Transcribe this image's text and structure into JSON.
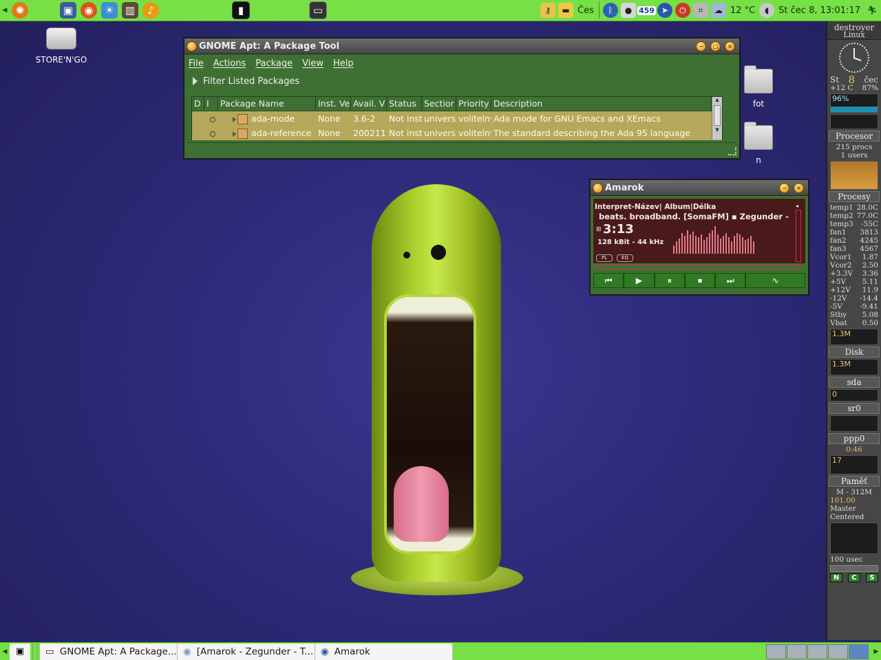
{
  "top_panel": {
    "launchers": [
      "ubuntu-icon",
      "network-icon",
      "firefox-icon",
      "weather-app-icon",
      "film-icon",
      "audio-icon",
      "terminal-app-icon",
      "monitor-app-icon"
    ],
    "keyboard_layout": "Čes",
    "notification_count": "459",
    "temperature": "12 °C",
    "clock": "St čec  8, 13:01:17"
  },
  "desktop": {
    "icons": [
      {
        "label": "STORE'N'GO"
      },
      {
        "label": "fot"
      },
      {
        "label": "n"
      }
    ]
  },
  "apt_window": {
    "title": "GNOME Apt: A Package Tool",
    "menu": [
      "File",
      "Actions",
      "Package",
      "View",
      "Help"
    ],
    "filter_label": "Filter Listed Packages",
    "columns": [
      "D",
      "I",
      "Package Name",
      "Inst. Ve",
      "Avail. V",
      "Status",
      "Sectior",
      "Priority",
      "Description"
    ],
    "rows": [
      {
        "name": "ada-mode",
        "inst": "None",
        "avail": "3.6-2",
        "status": "Not inst",
        "section": "univers",
        "priority": "volitelny",
        "description": "Ada mode for GNU Emacs and XEmacs"
      },
      {
        "name": "ada-reference",
        "inst": "None",
        "avail": "200211",
        "status": "Not inst",
        "section": "univers",
        "priority": "volitelny",
        "description": "The standard describing the Ada 95 language"
      }
    ]
  },
  "amarok": {
    "title": "Amarok",
    "header": "Interpret-Název| Album|Délka",
    "track": "beats. broadband. [SomaFM]  ▪  Zegunder -",
    "time": "3:13",
    "bitrate": "128 kBit - 44 kHz",
    "pl_label": "PL",
    "eq_label": "EQ",
    "spectrum": [
      12,
      18,
      22,
      30,
      26,
      34,
      28,
      32,
      26,
      24,
      28,
      20,
      24,
      30,
      34,
      40,
      28,
      22,
      26,
      30,
      24,
      18,
      26,
      30,
      28,
      24,
      20,
      22,
      26,
      18
    ]
  },
  "gkrellm": {
    "host": "destroyer",
    "os": "Linux",
    "day": "St",
    "date": "8",
    "month": "čec",
    "temp": "+12 C",
    "humidity": "87%",
    "cpu_label": "96%",
    "cpu": "Procesor",
    "procs": "215  procs",
    "users": "1  users",
    "procesy": "Procesy",
    "sensors": [
      {
        "k": "temp1",
        "v": "28.0C"
      },
      {
        "k": "temp2",
        "v": "77.0C"
      },
      {
        "k": "temp3",
        "v": "-55C"
      },
      {
        "k": "fan1",
        "v": "3813"
      },
      {
        "k": "fan2",
        "v": "4245"
      },
      {
        "k": "fan3",
        "v": "4567"
      },
      {
        "k": "Vcor1",
        "v": "1.87"
      },
      {
        "k": "Vcor2",
        "v": "2.50"
      },
      {
        "k": "+3.3V",
        "v": "3.36"
      },
      {
        "k": "+5V",
        "v": "5.11"
      },
      {
        "k": "+12V",
        "v": "11.9"
      },
      {
        "k": "-12V",
        "v": "-14.4"
      },
      {
        "k": "-5V",
        "v": "-9.41"
      },
      {
        "k": "Stby",
        "v": "5.08"
      },
      {
        "k": "Vbat",
        "v": "0.50"
      }
    ],
    "net_rate": "1.3M",
    "disk": "Disk",
    "disk_rate": "1.3M",
    "sda": "sda",
    "sda_val": "0",
    "sr0": "sr0",
    "ppp0": "ppp0",
    "ppp0_time": "0:46",
    "ppp0_val": "17",
    "mem": "Paměť",
    "mem_val": "M - 312M",
    "mem_pct": "101.00",
    "mixer1": "Master",
    "mixer2": "Centered",
    "usec": "100 usec",
    "buttons": [
      "N",
      "C",
      "S"
    ]
  },
  "taskbar": {
    "tasks": [
      {
        "label": "GNOME Apt: A Package..."
      },
      {
        "label": "[Amarok - Zegunder - T..."
      },
      {
        "label": "Amarok"
      }
    ]
  }
}
